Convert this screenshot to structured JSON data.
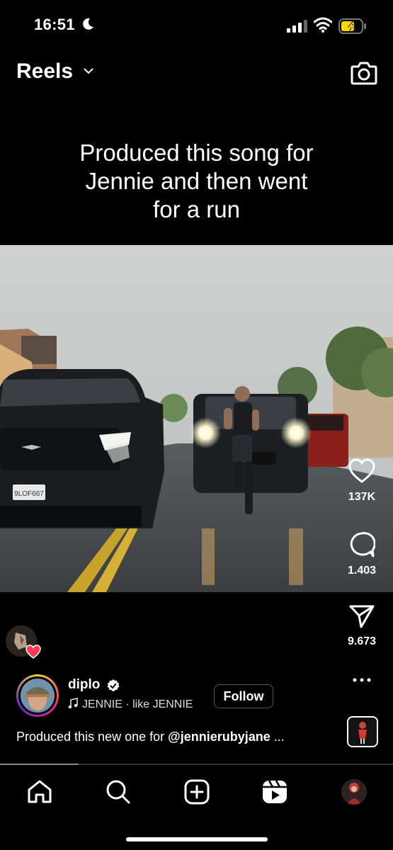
{
  "status": {
    "time": "16:51"
  },
  "header": {
    "title": "Reels"
  },
  "caption": {
    "line1": "Produced this song for",
    "line2": "Jennie and then went",
    "line3": "for a run"
  },
  "plate": "9LOF667",
  "actions": {
    "likes": "137K",
    "comments": "1.403",
    "shares": "9.673"
  },
  "post": {
    "username": "diplo",
    "audio": "JENNIE · like JENNIE",
    "follow_label": "Follow",
    "description": "Produced this new one for ",
    "mention": "@jennierubyjane",
    "ellipsis": " ..."
  },
  "progress": 0.2,
  "colors": {
    "accent": "#ffffff",
    "background": "#000000",
    "battery": "#ffd60a",
    "heart": "#ff3b5c"
  },
  "icons": [
    "moon-icon",
    "signal-icon",
    "wifi-icon",
    "battery-icon",
    "chevron-down-icon",
    "camera-icon",
    "heart-icon",
    "comment-icon",
    "share-icon",
    "verified-icon",
    "music-note-icon",
    "more-icon",
    "home-icon",
    "search-icon",
    "create-icon",
    "reels-icon",
    "profile-avatar"
  ]
}
